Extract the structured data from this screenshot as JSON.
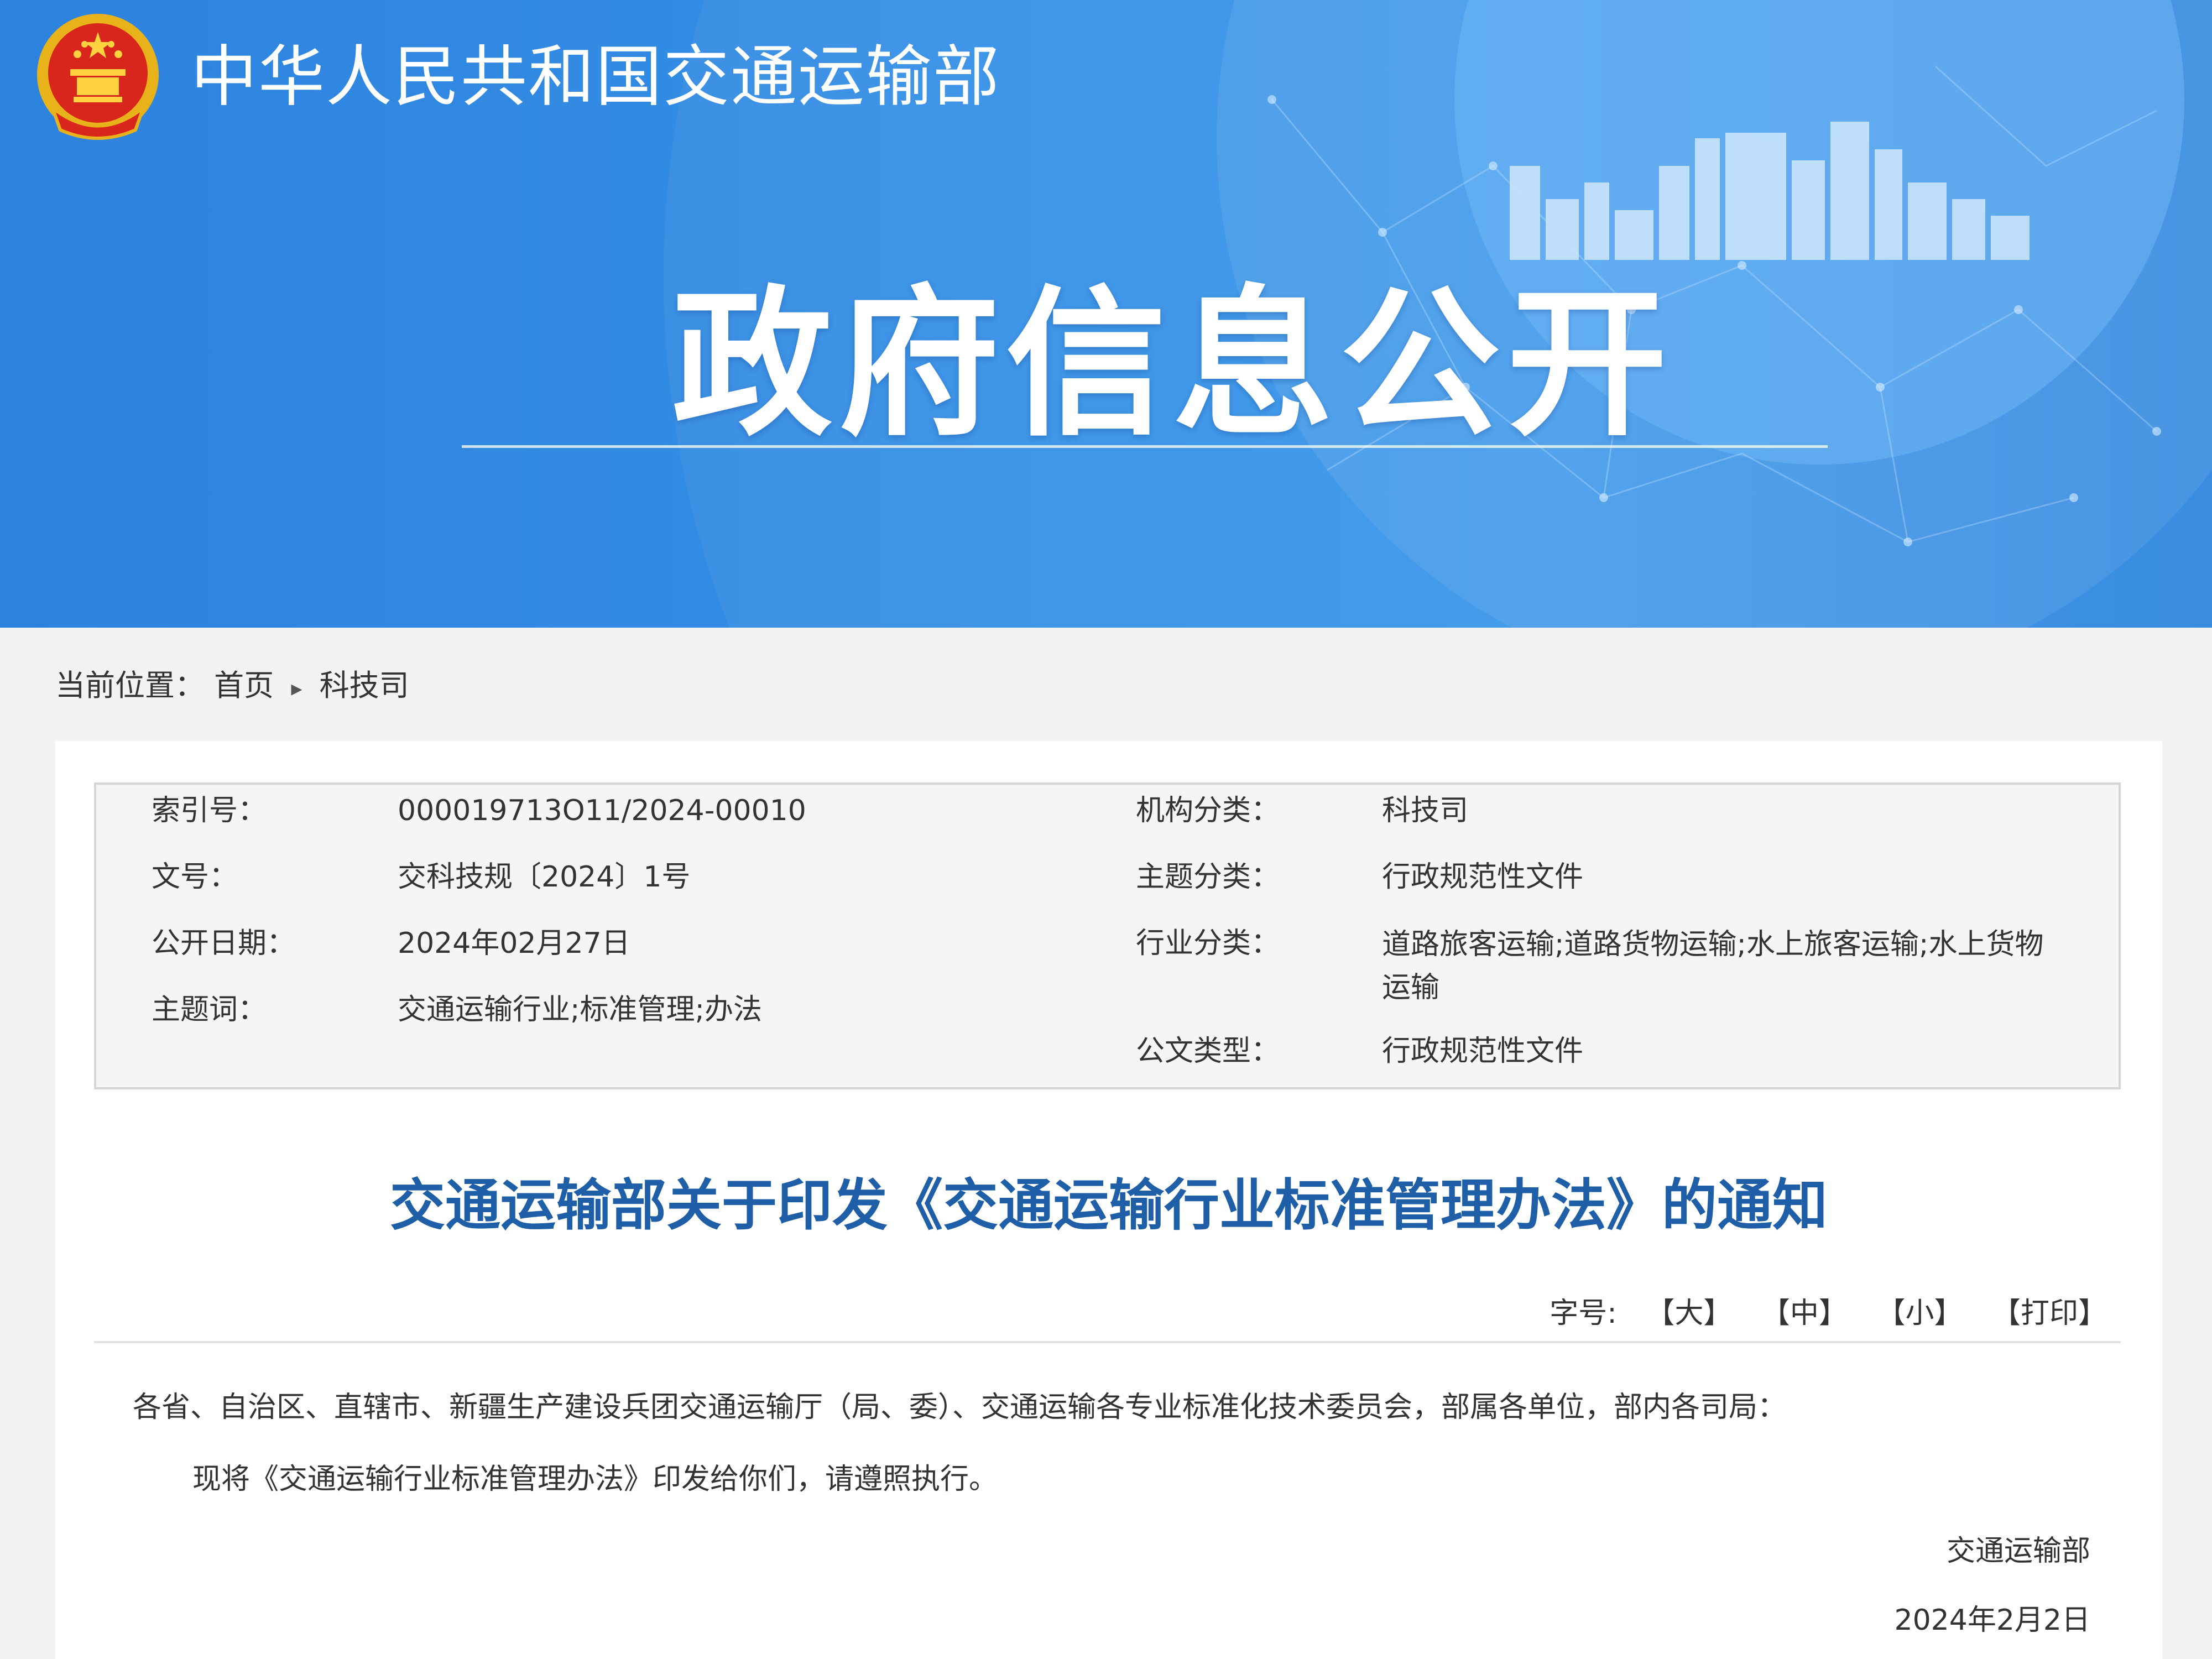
{
  "header": {
    "ministry_name": "中华人民共和国交通运输部",
    "section_title": "政府信息公开",
    "colors": {
      "banner_blue": "#3590e6",
      "title_blue": "#1f5fa8"
    }
  },
  "breadcrumb": {
    "label": "当前位置：",
    "items": [
      "首页",
      "科技司"
    ],
    "separator": "▸"
  },
  "meta": {
    "left": [
      {
        "label": "索引号：",
        "value": "000019713O11/2024-00010"
      },
      {
        "label": "文号：",
        "value": "交科技规〔2024〕1号"
      },
      {
        "label": "公开日期：",
        "value": "2024年02月27日"
      },
      {
        "label": "主题词：",
        "value": "交通运输行业;标准管理;办法"
      }
    ],
    "right": [
      {
        "label": "机构分类：",
        "value": "科技司"
      },
      {
        "label": "主题分类：",
        "value": "行政规范性文件"
      },
      {
        "label": "行业分类：",
        "value": "道路旅客运输;道路货物运输;水上旅客运输;水上货物运输"
      },
      {
        "label": "公文类型：",
        "value": "行政规范性文件"
      }
    ]
  },
  "document": {
    "title": "交通运输部关于印发《交通运输行业标准管理办法》的通知",
    "font_size_label": "字号:",
    "tools": [
      "【大】",
      "【中】",
      "【小】",
      "【打印】"
    ],
    "salutation": "各省、自治区、直辖市、新疆生产建设兵团交通运输厅（局、委）、交通运输各专业标准化技术委员会，部属各单位，部内各司局：",
    "body": "现将《交通运输行业标准管理办法》印发给你们，请遵照执行。",
    "signature": "交通运输部",
    "date": "2024年2月2日"
  }
}
